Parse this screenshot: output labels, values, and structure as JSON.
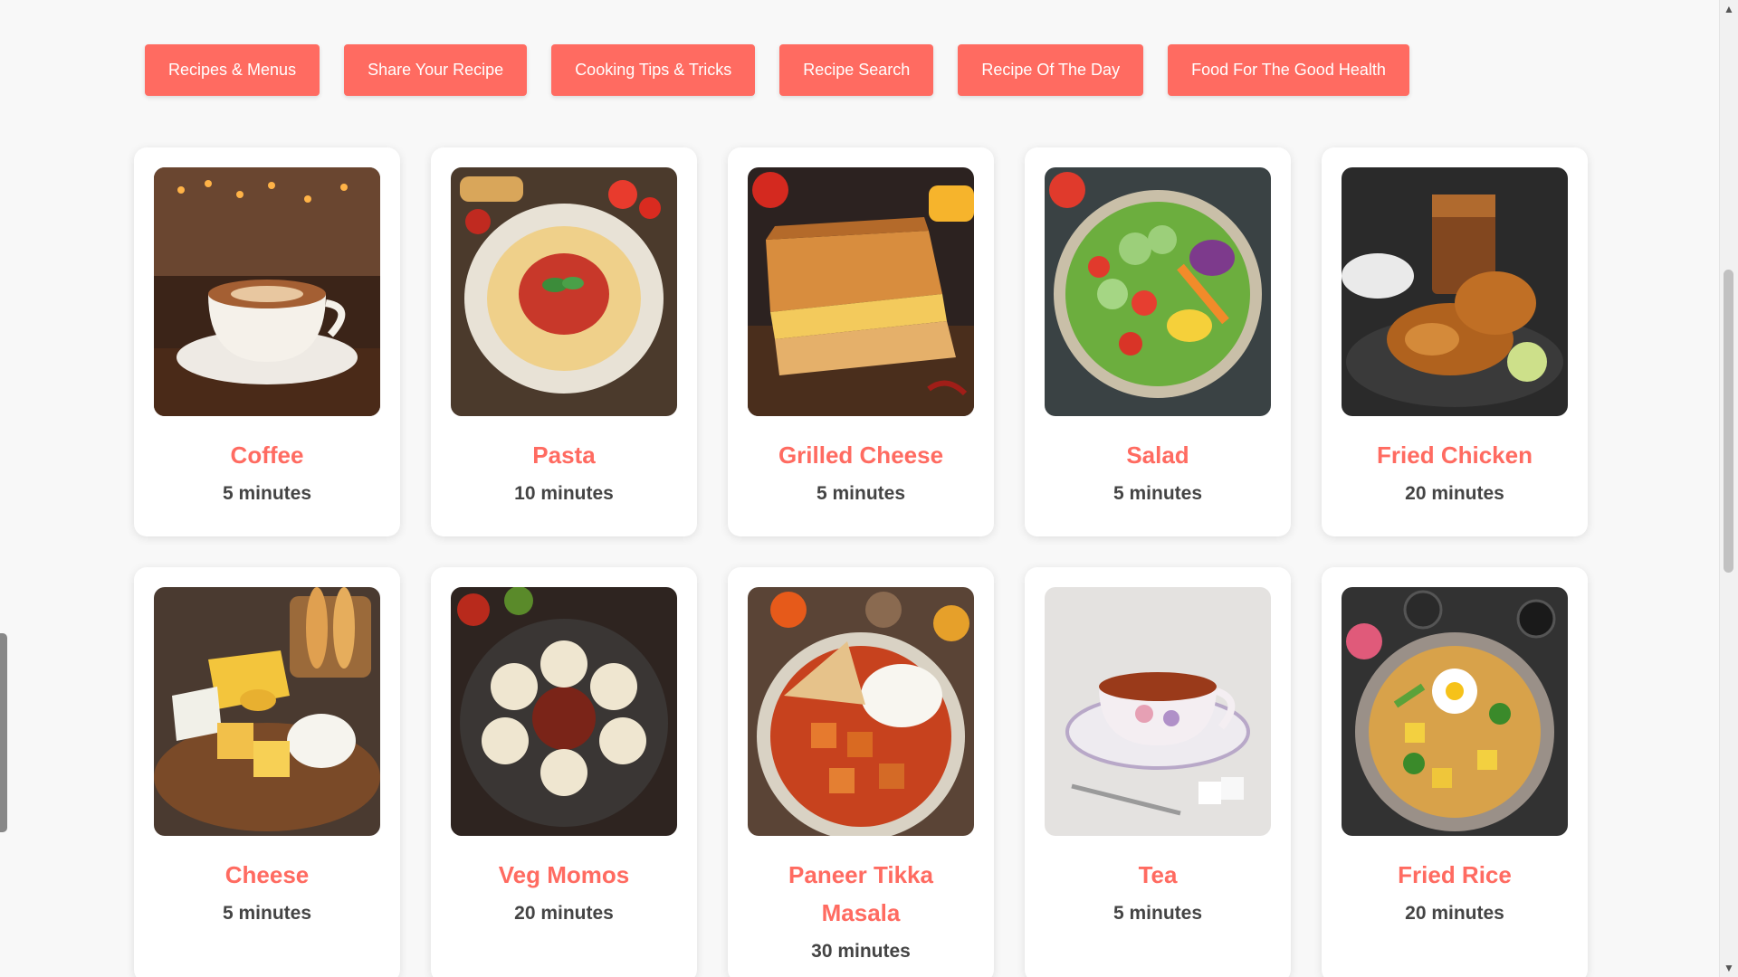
{
  "nav": [
    {
      "label": "Recipes & Menus"
    },
    {
      "label": "Share Your Recipe"
    },
    {
      "label": "Cooking Tips & Tricks"
    },
    {
      "label": "Recipe Search"
    },
    {
      "label": "Recipe Of The Day"
    },
    {
      "label": "Food For The Good Health"
    }
  ],
  "recipes": [
    {
      "title": "Coffee",
      "time": "5 minutes"
    },
    {
      "title": "Pasta",
      "time": "10 minutes"
    },
    {
      "title": "Grilled Cheese",
      "time": "5 minutes"
    },
    {
      "title": "Salad",
      "time": "5 minutes"
    },
    {
      "title": "Fried Chicken",
      "time": "20 minutes"
    },
    {
      "title": "Cheese",
      "time": "5 minutes"
    },
    {
      "title": "Veg Momos",
      "time": "20 minutes"
    },
    {
      "title": "Paneer Tikka Masala",
      "time": "30 minutes"
    },
    {
      "title": "Tea",
      "time": "5 minutes"
    },
    {
      "title": "Fried Rice",
      "time": "20 minutes"
    }
  ],
  "colors": {
    "accent": "#ff6b61",
    "text": "#444444",
    "background": "#f8f8f8"
  },
  "icons": {
    "scroll_up": "scroll-up-arrow-icon",
    "scroll_down": "scroll-down-arrow-icon"
  }
}
